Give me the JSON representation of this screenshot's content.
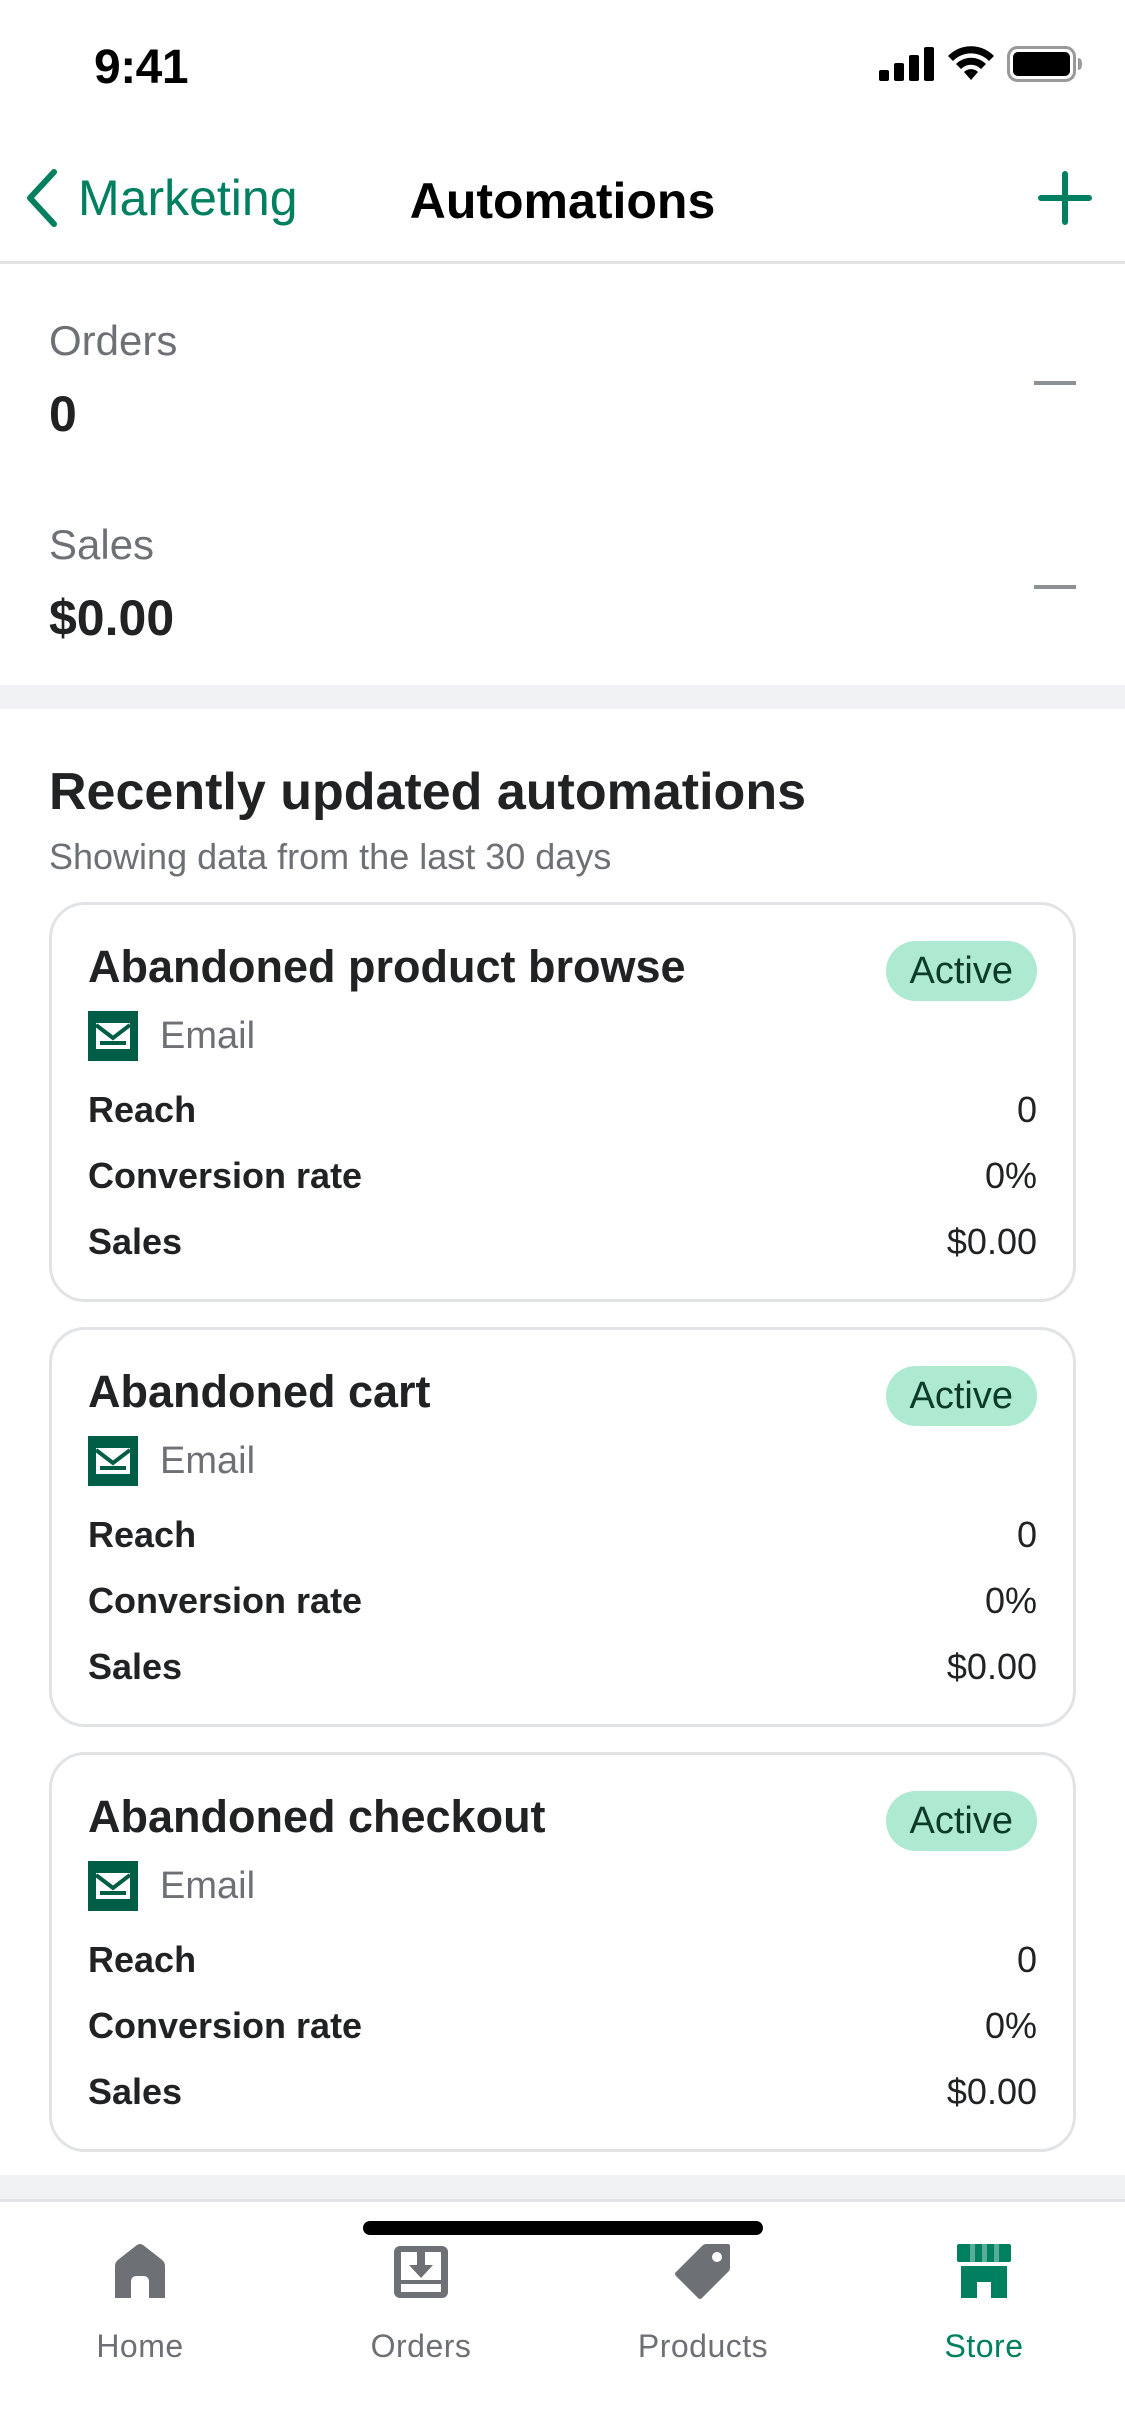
{
  "status_bar": {
    "time": "9:41"
  },
  "nav": {
    "back_label": "Marketing",
    "title": "Automations",
    "accent_color": "#008060"
  },
  "metrics": [
    {
      "label": "Orders",
      "value": "0"
    },
    {
      "label": "Sales",
      "value": "$0.00"
    }
  ],
  "automations": {
    "heading": "Recently updated automations",
    "subheading": "Showing data from the last 30 days",
    "cards": [
      {
        "title": "Abandoned product browse",
        "status": "Active",
        "channel": "Email",
        "stats": [
          {
            "label": "Reach",
            "value": "0"
          },
          {
            "label": "Conversion rate",
            "value": "0%"
          },
          {
            "label": "Sales",
            "value": "$0.00"
          }
        ]
      },
      {
        "title": "Abandoned cart",
        "status": "Active",
        "channel": "Email",
        "stats": [
          {
            "label": "Reach",
            "value": "0"
          },
          {
            "label": "Conversion rate",
            "value": "0%"
          },
          {
            "label": "Sales",
            "value": "$0.00"
          }
        ]
      },
      {
        "title": "Abandoned checkout",
        "status": "Active",
        "channel": "Email",
        "stats": [
          {
            "label": "Reach",
            "value": "0"
          },
          {
            "label": "Conversion rate",
            "value": "0%"
          },
          {
            "label": "Sales",
            "value": "$0.00"
          }
        ]
      }
    ]
  },
  "tab_bar": {
    "tabs": [
      {
        "label": "Home",
        "icon": "home-icon",
        "active": false
      },
      {
        "label": "Orders",
        "icon": "orders-inbox-icon",
        "active": false
      },
      {
        "label": "Products",
        "icon": "tag-icon",
        "active": false
      },
      {
        "label": "Store",
        "icon": "store-icon",
        "active": true
      }
    ]
  }
}
